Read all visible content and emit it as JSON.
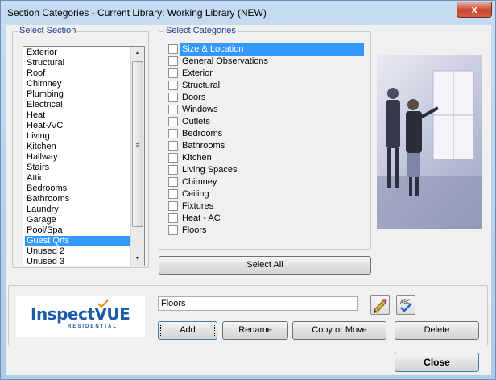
{
  "window": {
    "title": "Section Categories - Current Library: Working Library (NEW)",
    "close_glyph": "x"
  },
  "select_section": {
    "legend": "Select Section",
    "items": [
      "Exterior",
      "Structural",
      "Roof",
      "Chimney",
      "Plumbing",
      "Electrical",
      "Heat",
      "Heat-A/C",
      "Living",
      "Kitchen",
      "Hallway",
      "Stairs",
      "Attic",
      "Bedrooms",
      "Bathrooms",
      "Laundry",
      "Garage",
      "Pool/Spa",
      "Guest Qrts",
      "Unused 2",
      "Unused 3"
    ],
    "selected": "Guest Qrts"
  },
  "select_categories": {
    "legend": "Select Categories",
    "items": [
      "Size & Location",
      "General Observations",
      "Exterior",
      "Structural",
      "Doors",
      "Windows",
      "Outlets",
      "Bedrooms",
      "Bathrooms",
      "Kitchen",
      "Living Spaces",
      "Chimney",
      "Ceiling",
      "Fixtures",
      "Heat - AC",
      "Floors"
    ],
    "selected": "Size & Location",
    "select_all_label": "Select All"
  },
  "editor": {
    "name_value": "Floors",
    "add_label": "Add",
    "rename_label": "Rename",
    "copy_move_label": "Copy or Move",
    "delete_label": "Delete",
    "spell_check_icon_text": "ABC"
  },
  "logo": {
    "word_main": "Inspect",
    "word_accent": "VUE",
    "subtitle": "RESIDENTIAL"
  },
  "footer": {
    "close_label": "Close"
  },
  "colors": {
    "selection": "#3399ff",
    "legend_text": "#1a3c8f",
    "logo_blue": "#1b5aa6"
  }
}
